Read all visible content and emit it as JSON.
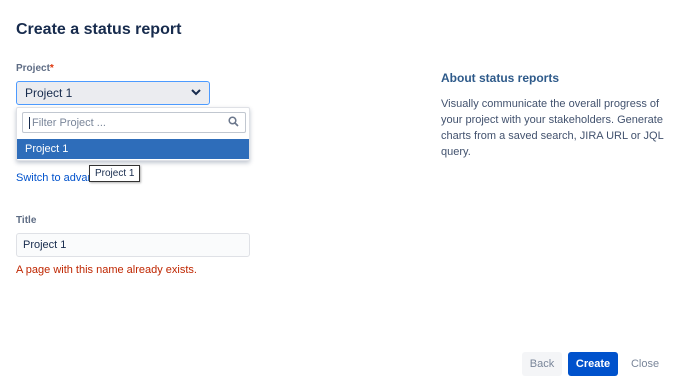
{
  "dialog": {
    "title": "Create a status report"
  },
  "project_field": {
    "label": "Project",
    "required_marker": "*",
    "selected_value": "Project 1",
    "dropdown_icon": "chevron-down-icon",
    "filter_placeholder": "Filter Project ...",
    "filter_icon": "search-icon",
    "options": [
      "Project 1"
    ],
    "highlighted_option": "Project 1"
  },
  "switch_link": {
    "label": "Switch to advar"
  },
  "tooltip": {
    "text": "Project 1"
  },
  "title_field": {
    "label": "Title",
    "value": "Project 1",
    "error": "A page with this name already exists."
  },
  "about": {
    "heading": "About status reports",
    "body": "Visually communicate the overall progress of your project with your stakeholders. Generate charts from a saved search, JIRA URL or JQL query."
  },
  "footer": {
    "back_label": "Back",
    "create_label": "Create",
    "close_label": "Close"
  },
  "colors": {
    "primary": "#0052cc",
    "selected_option": "#2e6dba",
    "error": "#bf2600"
  }
}
